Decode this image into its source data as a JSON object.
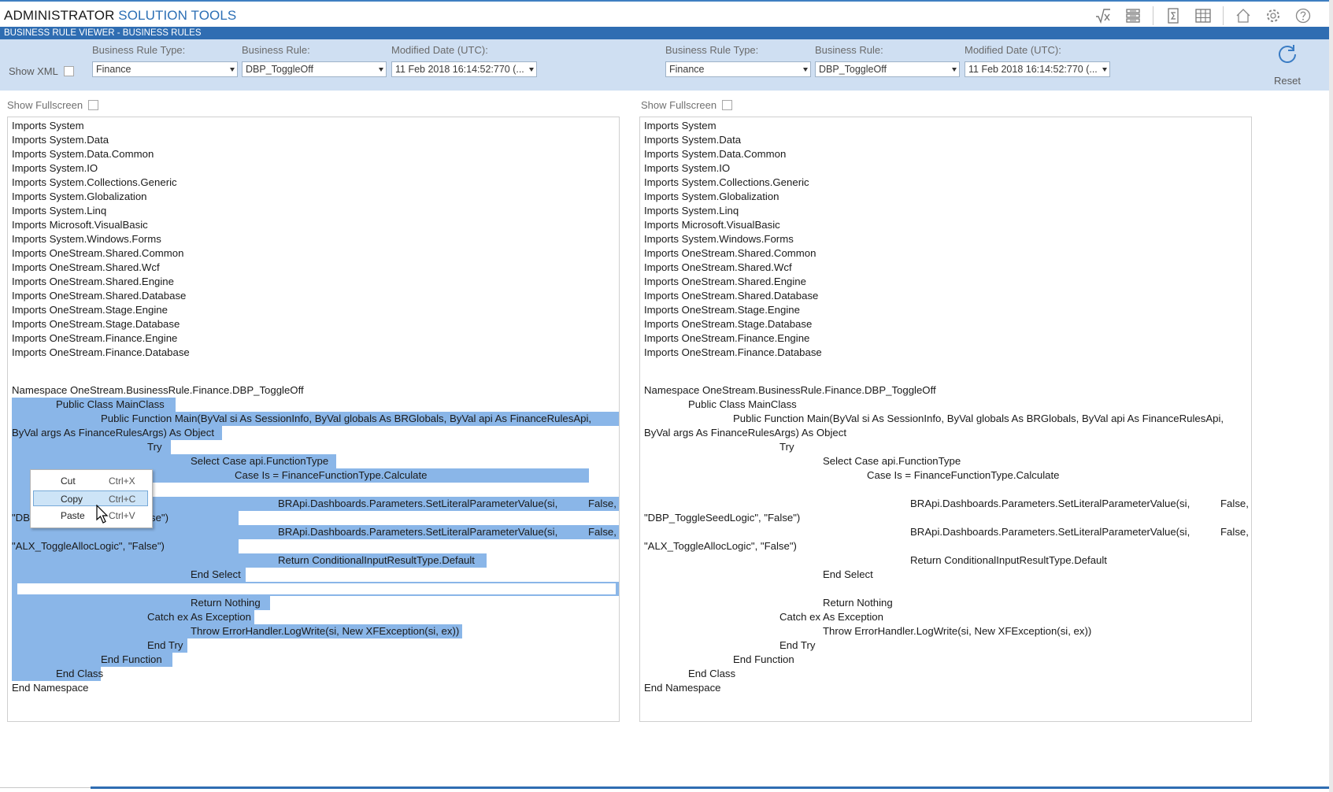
{
  "app": {
    "title_part1": "ADMINISTRATOR",
    "title_part2": "SOLUTION TOOLS",
    "toolbar_icons": [
      "formula-icon",
      "stack-icon",
      "sigma-doc-icon",
      "grid-icon",
      "home-icon",
      "gear-icon",
      "help-icon"
    ]
  },
  "header": {
    "strip_text": "BUSINESS RULE VIEWER - BUSINESS RULES"
  },
  "filters": {
    "show_xml_label": "Show XML",
    "left": {
      "rule_type_label": "Business Rule Type:",
      "rule_type_value": "Finance",
      "rule_label": "Business Rule:",
      "rule_value": "DBP_ToggleOff",
      "modified_label": "Modified Date (UTC):",
      "modified_value": "11 Feb 2018 16:14:52:770 (..."
    },
    "right": {
      "rule_type_label": "Business Rule Type:",
      "rule_type_value": "Finance",
      "rule_label": "Business Rule:",
      "rule_value": "DBP_ToggleOff",
      "modified_label": "Modified Date (UTC):",
      "modified_value": "11 Feb 2018 16:14:52:770 (..."
    },
    "reset_label": "Reset"
  },
  "panels": {
    "fullscreen_label": "Show Fullscreen",
    "imports": [
      "Imports System",
      "Imports System.Data",
      "Imports System.Data.Common",
      "Imports System.IO",
      "Imports System.Collections.Generic",
      "Imports System.Globalization",
      "Imports System.Linq",
      "Imports Microsoft.VisualBasic",
      "Imports System.Windows.Forms",
      "Imports OneStream.Shared.Common",
      "Imports OneStream.Shared.Wcf",
      "Imports OneStream.Shared.Engine",
      "Imports OneStream.Shared.Database",
      "Imports OneStream.Stage.Engine",
      "Imports OneStream.Stage.Database",
      "Imports OneStream.Finance.Engine",
      "Imports OneStream.Finance.Database"
    ],
    "body": {
      "namespace": "Namespace OneStream.BusinessRule.Finance.DBP_ToggleOff",
      "class": "Public Class MainClass",
      "function_a": "Public Function Main(ByVal si As SessionInfo, ByVal globals As BRGlobals, ByVal api As FinanceRulesApi,",
      "function_b": "ByVal args As FinanceRulesArgs) As Object",
      "try": "Try",
      "select_case": "Select Case api.FunctionType",
      "case_is": "Case Is = FinanceFunctionType.Calculate",
      "setparam1_a": "BRApi.Dashboards.Parameters.SetLiteralParameterValue(si,",
      "setparam1_false": "False,",
      "setparam1_b": "\"DBP_ToggleSeedLogic\", \"False\")",
      "setparam2_a": "BRApi.Dashboards.Parameters.SetLiteralParameterValue(si,",
      "setparam2_false": "False,",
      "setparam2_b": "\"ALX_ToggleAllocLogic\", \"False\")",
      "return_default": "Return ConditionalInputResultType.Default",
      "end_select": "End Select",
      "return_nothing": "Return Nothing",
      "catch": "Catch ex As Exception",
      "throw": "Throw ErrorHandler.LogWrite(si, New XFException(si, ex))",
      "end_try": "End Try",
      "end_function": "End Function",
      "end_class": "End Class",
      "end_namespace": "End Namespace"
    },
    "left_partial": {
      "param1_prefix": "\"DB",
      "param1_suffix": "se\")"
    }
  },
  "context_menu": {
    "items": [
      {
        "label": "Cut",
        "shortcut": "Ctrl+X"
      },
      {
        "label": "Copy",
        "shortcut": "Ctrl+C"
      },
      {
        "label": "Paste",
        "shortcut": "Ctrl+V"
      }
    ]
  }
}
